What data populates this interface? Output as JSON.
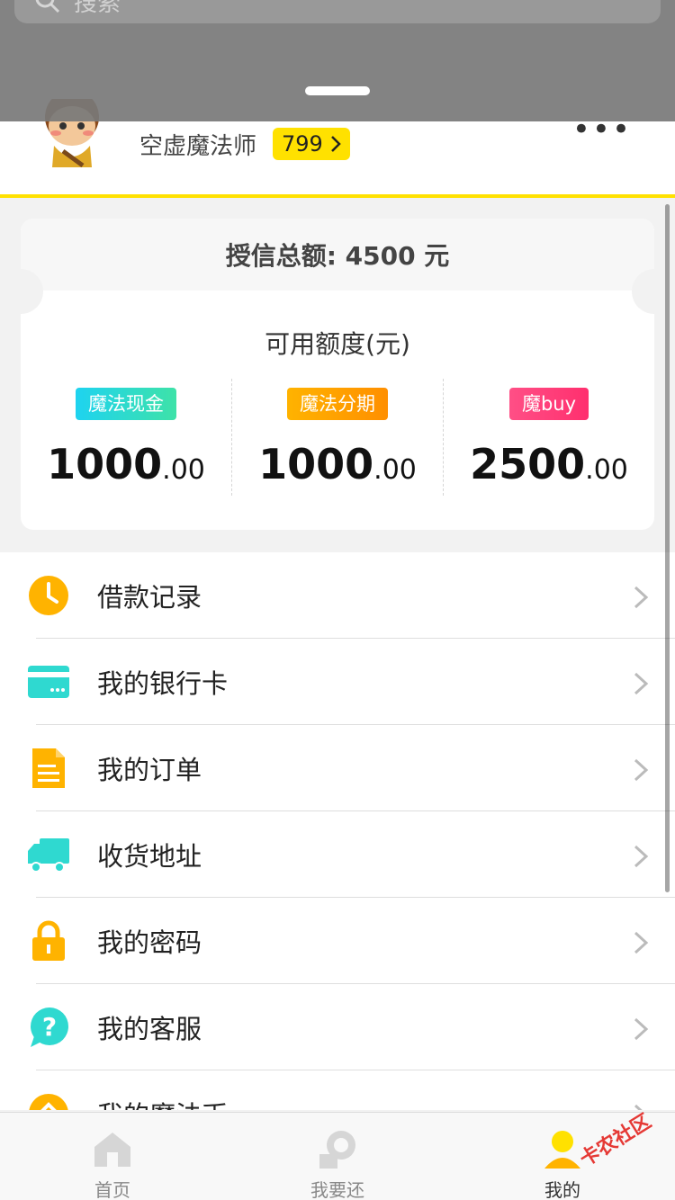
{
  "search": {
    "placeholder": "搜索"
  },
  "profile": {
    "nickname": "空虚魔法师",
    "score": "799"
  },
  "credit": {
    "total_label": "授信总额: 4500 元",
    "available_label": "可用额度(元)",
    "products": [
      {
        "tag": "魔法现金",
        "integer": "1000",
        "decimal": ".00"
      },
      {
        "tag": "魔法分期",
        "integer": "1000",
        "decimal": ".00"
      },
      {
        "tag": "魔buy",
        "integer": "2500",
        "decimal": ".00"
      }
    ]
  },
  "menu": {
    "items": [
      {
        "label": "借款记录",
        "icon": "clock-icon"
      },
      {
        "label": "我的银行卡",
        "icon": "bank-card-icon"
      },
      {
        "label": "我的订单",
        "icon": "order-document-icon"
      },
      {
        "label": "收货地址",
        "icon": "delivery-truck-icon"
      },
      {
        "label": "我的密码",
        "icon": "lock-icon"
      },
      {
        "label": "我的客服",
        "icon": "help-chat-icon"
      },
      {
        "label": "我的魔法币",
        "icon": "coin-icon"
      }
    ]
  },
  "tabs": [
    {
      "label": "首页",
      "icon": "home-icon"
    },
    {
      "label": "我要还",
      "icon": "repay-icon"
    },
    {
      "label": "我的",
      "icon": "user-icon"
    }
  ],
  "watermark": {
    "text": "卡农社区"
  },
  "colors": {
    "accent": "#ffe100",
    "cyan": "#1ed3f0",
    "orange": "#ff9f00",
    "pink": "#ff3f7a"
  }
}
